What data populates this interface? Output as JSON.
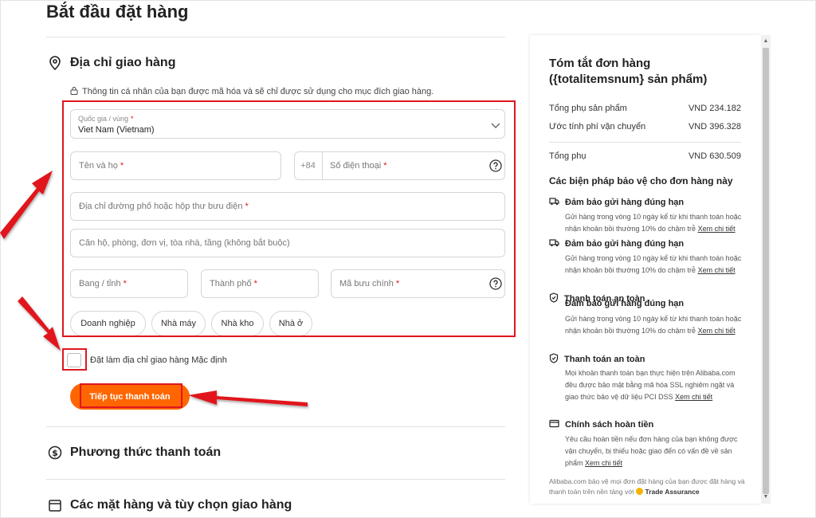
{
  "page": {
    "title": "Bắt đầu đặt hàng"
  },
  "shipping": {
    "title": "Địa chỉ giao hàng",
    "privacy_note": "Thông tin cá nhân của bạn được mã hóa và sẽ chỉ được sử dụng cho mục đích giao hàng.",
    "country_label": "Quốc gia / vùng",
    "country_value": "Viet Nam (Vietnam)",
    "name_placeholder": "Tên và họ",
    "phone_prefix": "+84",
    "phone_placeholder": "Số điện thoại",
    "street_placeholder": "Địa chỉ đường phố hoặc hộp thư bưu điện",
    "apt_placeholder": "Căn hộ, phòng, đơn vị, tòa nhà, tầng (không bắt buộc)",
    "state_placeholder": "Bang / tỉnh",
    "city_placeholder": "Thành phố",
    "zip_placeholder": "Mã bưu chính",
    "required_mark": "*",
    "address_types": [
      "Doanh nghiệp",
      "Nhà máy",
      "Nhà kho",
      "Nhà ở"
    ],
    "default_checkbox_label": "Đặt làm địa chỉ giao hàng Mặc định",
    "continue_button": "Tiếp tục thanh toán"
  },
  "payment": {
    "title": "Phương thức thanh toán"
  },
  "items": {
    "title": "Các mặt hàng và tùy chọn giao hàng"
  },
  "summary": {
    "title_line1": "Tóm tắt đơn hàng",
    "title_line2": "({totalitemsnum} sản phẩm)",
    "subtotal_label": "Tổng phụ sản phẩm",
    "subtotal_value": "VND 234.182",
    "shipping_label": "Ước tính phí vận chuyển",
    "shipping_value": "VND 396.328",
    "total_label": "Tổng phụ",
    "total_value": "VND 630.509",
    "protection_title": "Các biện pháp bảo vệ cho đơn hàng này",
    "ontime_title": "Đảm bảo gửi hàng đúng hạn",
    "ontime_text": "Gửi hàng trong vòng 10 ngày kể từ khi thanh toán hoặc nhận khoản bồi thường 10% do chậm trễ",
    "detail_link": "Xem chi tiết",
    "secure_title": "Thanh toán an toàn",
    "secure_text": "Mọi khoản thanh toán bạn thực hiện trên Alibaba.com đều được bảo mật bằng mã hóa SSL nghiêm ngặt và giao thức bảo vệ dữ liệu PCI DSS",
    "refund_title": "Chính sách hoàn tiền",
    "refund_text": "Yêu cầu hoàn tiền nếu đơn hàng của bạn không được vận chuyển, bị thiếu hoặc giao đến có vấn đề về sản phẩm",
    "footer_note": "Alibaba.com bảo vệ mọi đơn đặt hàng của bạn được đặt hàng và thanh toán trên nền tảng với",
    "trade_assurance": "Trade Assurance"
  },
  "colors": {
    "accent": "#ff6600",
    "annotation": "#e0161e"
  }
}
